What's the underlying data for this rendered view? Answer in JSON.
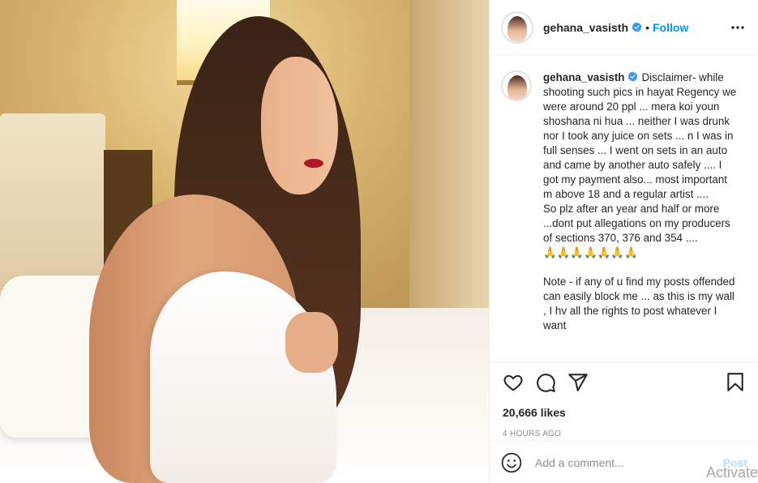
{
  "header": {
    "username": "gehana_vasisth",
    "separator": "•",
    "follow_label": "Follow",
    "more_icon": "more-horizontal-icon"
  },
  "caption": {
    "username": "gehana_vasisth",
    "text": "Disclaimer- while shooting such pics in hayat Regency we were around 20 ppl ... mera koi youn shoshana ni hua ... neither I was drunk nor I took any juice on sets ... n I was in full senses ... I went on sets in an auto and came by another auto safely .... I got my payment also... most important m above 18 and a regular artist ....\nSo plz after an year and half or more ...dont put allegations on my producers of sections 370, 376 and 354 ....\n🙏🙏🙏🙏🙏🙏🙏\n\nNote - if any of u find my posts offended can easily block me ... as this is my wall , I hv all the rights to post whatever I want"
  },
  "actions": {
    "like_icon": "heart-icon",
    "comment_icon": "comment-icon",
    "share_icon": "paper-plane-icon",
    "save_icon": "bookmark-icon"
  },
  "likes": "20,666 likes",
  "timestamp": "4 HOURS AGO",
  "comment_box": {
    "placeholder": "Add a comment...",
    "post_label": "Post"
  },
  "overlay_text": "Activate",
  "colors": {
    "accent": "#0095f6",
    "verified": "#3897f0",
    "post_disabled": "#b2dffc",
    "muted": "#8e8e8e"
  }
}
